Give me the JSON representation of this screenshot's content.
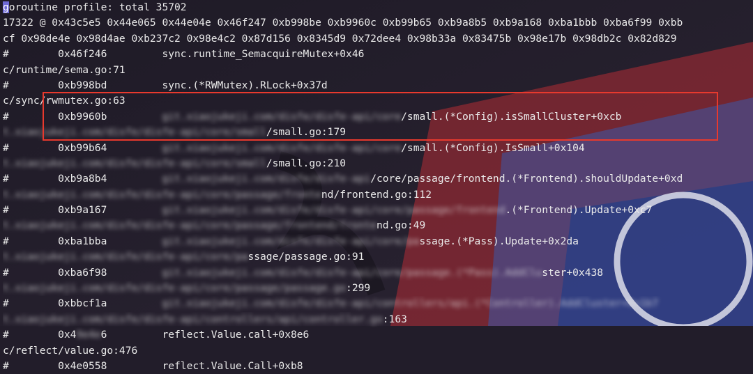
{
  "terminal": {
    "line1": {
      "cursor": "g",
      "rest": "oroutine profile: total 35702"
    },
    "line2": "17322 @ 0x43c5e5 0x44e065 0x44e04e 0x46f247 0xb998be 0xb9960c 0xb99b65 0xb9a8b5 0xb9a168 0xba1bbb 0xba6f99 0xbb",
    "line3": "cf 0x98de4e 0x98d4ae 0xb237c2 0x98e4c2 0x87d156 0x8345d9 0x72dee4 0x98b33a 0x83475b 0x98e17b 0x98db2c 0x82d829",
    "f1": {
      "prefix": "#        0x46f246         ",
      "func": "sync.runtime_SemacquireMutex+0x46"
    },
    "p1": "c/runtime/sema.go:71",
    "f2": {
      "prefix": "#        0xb998bd         ",
      "func": "sync.(*RWMutex).RLock+0x37d"
    },
    "p2": "c/sync/rwmutex.go:63",
    "f3": {
      "prefix": "#        0xb9960b         ",
      "blur": "git.xiaojukeji.com/disfe/disfe-api/core",
      "func": "/small.(*Config).isSmallCluster+0xcb"
    },
    "p3": {
      "blur": "t.xiaojukeji.com/disfe/disfe-api/core/small",
      "path": "/small.go:179"
    },
    "f4": {
      "prefix": "#        0xb99b64         ",
      "blur": "git.xiaojukeji.com/disfe/disfe-api/core",
      "func": "/small.(*Config).IsSmall+0x104"
    },
    "p4": {
      "blur": "t.xiaojukeji.com/disfe/disfe-api/core/small",
      "path": "/small.go:210"
    },
    "f5": {
      "prefix": "#        0xb9a8b4         ",
      "blur": "git.xiaojukeji.com/disfe/disfe-api",
      "mid": "/core/passage/frontend.(*Frontend)",
      "func": ".shouldUpdate+0xd"
    },
    "p5": {
      "blur": "t.xiaojukeji.com/disfe/disfe-api/core/passage/fronte",
      "path": "nd/frontend.go:112"
    },
    "f6": {
      "prefix": "#        0xb9a167         ",
      "blur": "git.xiaojukeji.com/disfe/disfe-api/core/passage/frontend",
      "func": ".(*Frontend).Update+0xc7"
    },
    "p6": {
      "blur": "t.xiaojukeji.com/disfe/disfe-api/core/passage/frontend/fronte",
      "path": "nd.go:49"
    },
    "f7": {
      "prefix": "#        0xba1bba         ",
      "blur": "git.xiaojukeji.com/disfe/disfe-api/core/pa",
      "func": "ssage.(*Pass).Update+0x2da"
    },
    "p7": {
      "blur": "t.xiaojukeji.com/disfe/disfe-api/core/pa",
      "path": "ssage/passage.go:91"
    },
    "f8": {
      "prefix": "#        0xba6f98         ",
      "blur": "git.xiaojukeji.com/disfe/disfe-api/core/passage.(*Pass).AddClu",
      "func": "ster+0x438"
    },
    "p8": {
      "blur": "t.xiaojukeji.com/disfe/disfe-api/core/passage/passage.go",
      "path": ":299"
    },
    "f9": {
      "prefix": "#        0xbbcf1a         ",
      "blur": "git.xiaojukeji.com/disfe/disfe-api/controllers/api.(*Controller).AddCluster+0x1b7",
      "func": ""
    },
    "p9": {
      "blur": "t.xiaojukeji.com/disfe/disfe-api/controllers/api/controller.go",
      "path": ":163"
    },
    "f10": {
      "prefix": "#        0x4",
      "blur": "9e4e",
      "mid": "6         ",
      "func": "reflect.Value.call+0x8e6"
    },
    "p10": "c/reflect/value.go:476",
    "f11": {
      "prefix": "#        0x4e0558         ",
      "func": "reflect.Value.Call+0xb8"
    }
  }
}
